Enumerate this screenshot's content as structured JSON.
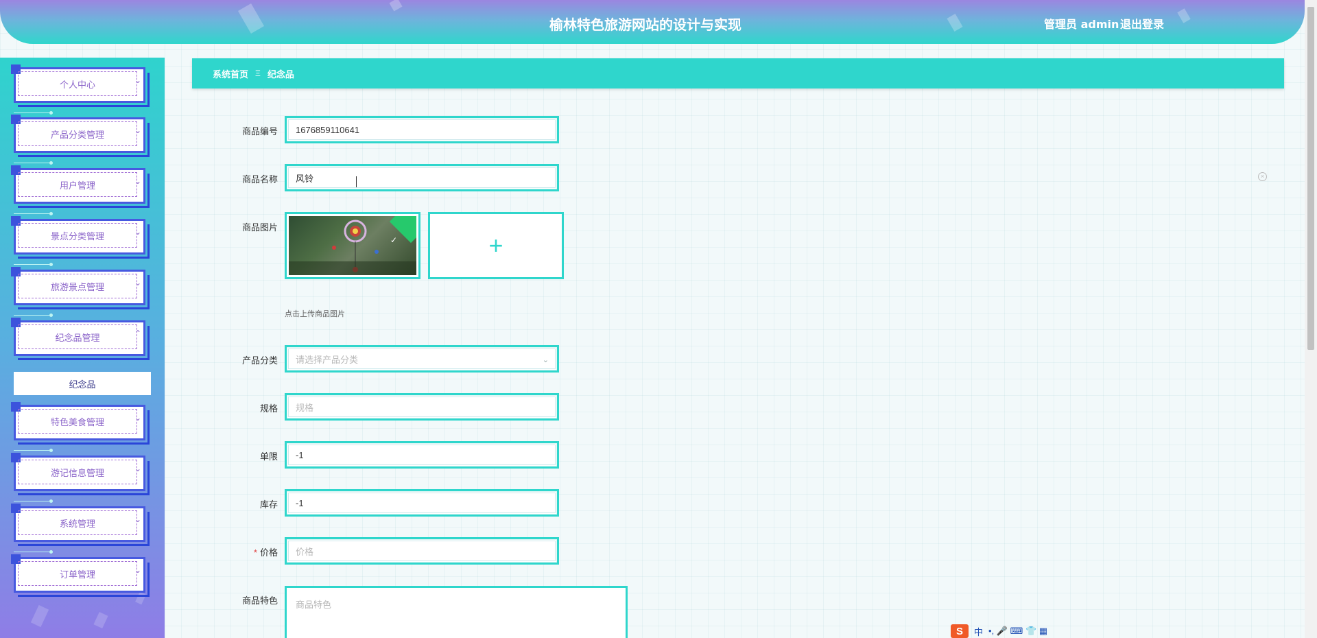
{
  "header": {
    "title": "榆林特色旅游网站的设计与实现",
    "user_label": "管理员 admin",
    "logout_label": "退出登录"
  },
  "sidebar": {
    "items": [
      {
        "label": "个人中心"
      },
      {
        "label": "产品分类管理"
      },
      {
        "label": "用户管理"
      },
      {
        "label": "景点分类管理"
      },
      {
        "label": "旅游景点管理"
      },
      {
        "label": "纪念品管理"
      },
      {
        "label": "特色美食管理"
      },
      {
        "label": "游记信息管理"
      },
      {
        "label": "系统管理"
      },
      {
        "label": "订单管理"
      }
    ],
    "active_submenu": "纪念品"
  },
  "breadcrumb": {
    "home": "系统首页",
    "separator": "Ξ",
    "current": "纪念品"
  },
  "form": {
    "code_label": "商品编号",
    "code_value": "1676859110641",
    "name_label": "商品名称",
    "name_value": "风铃",
    "image_label": "商品图片",
    "image_hint": "点击上传商品图片",
    "category_label": "产品分类",
    "category_placeholder": "请选择产品分类",
    "spec_label": "规格",
    "spec_placeholder": "规格",
    "limit_label": "单限",
    "limit_value": "-1",
    "stock_label": "库存",
    "stock_value": "-1",
    "price_label": "价格",
    "price_required": "*",
    "price_placeholder": "价格",
    "feature_label": "商品特色",
    "feature_placeholder": "商品特色"
  },
  "ime": {
    "logo": "S",
    "mode": "中",
    "symbols": "•, 🎤 ⌨ 👕 ▦"
  },
  "colors": {
    "accent": "#2fd6cc",
    "menu_border": "#4759e0",
    "menu_text": "#8a63c9",
    "header_top": "#9b86e0"
  }
}
